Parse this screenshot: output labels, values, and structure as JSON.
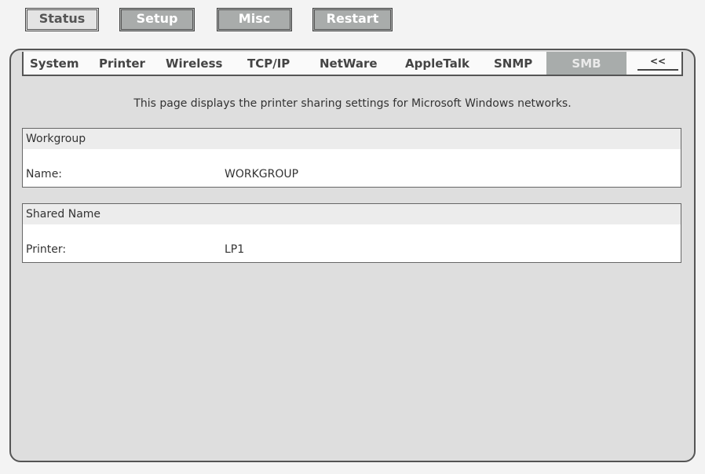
{
  "top_nav": {
    "status": "Status",
    "setup": "Setup",
    "misc": "Misc",
    "restart": "Restart"
  },
  "tabs": {
    "system": "System",
    "printer": "Printer",
    "wireless": "Wireless",
    "tcpip": "TCP/IP",
    "netware": "NetWare",
    "appletalk": "AppleTalk",
    "snmp": "SNMP",
    "smb": "SMB",
    "back": "<<"
  },
  "main": {
    "description": "This page displays the printer sharing settings for Microsoft Windows networks.",
    "workgroup": {
      "header": "Workgroup",
      "name_label": "Name:",
      "name_value": "WORKGROUP"
    },
    "shared_name": {
      "header": "Shared Name",
      "printer_label": "Printer:",
      "printer_value": "LP1"
    }
  },
  "colors": {
    "page_bg": "#f3f3f3",
    "panel_bg": "#dedede",
    "selected_tab": "#a8acab",
    "inactive_button": "#a9acab"
  }
}
